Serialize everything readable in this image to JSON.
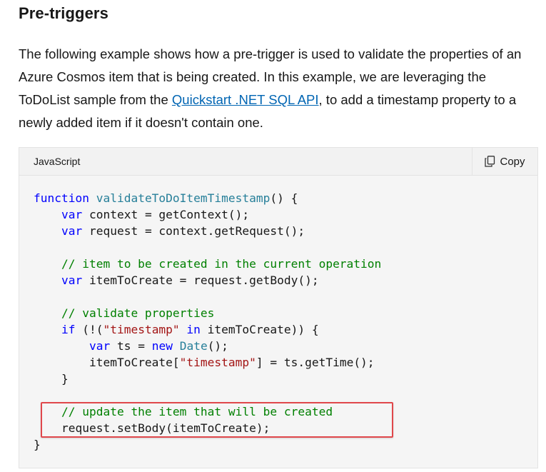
{
  "heading": "Pre-triggers",
  "paragraph": {
    "before_link": "The following example shows how a pre-trigger is used to validate the properties of an Azure Cosmos item that is being created. In this example, we are leveraging the ToDoList sample from the ",
    "link_text": "Quickstart .NET SQL API",
    "after_link": ", to add a timestamp property to a newly added item if it doesn't contain one."
  },
  "code_block": {
    "language": "JavaScript",
    "copy_label": "Copy",
    "copy_icon": "copy-icon",
    "highlight_color": "#e0474b",
    "lines": {
      "l1_kw": "function",
      "l1_fn": "validateToDoItemTimestamp",
      "l1_rest": "() {",
      "l2_kw": "var",
      "l2_rest": " context = getContext();",
      "l3_kw": "var",
      "l3_rest": " request = context.getRequest();",
      "l5_cm": "// item to be created in the current operation",
      "l6_kw": "var",
      "l6_rest": " itemToCreate = request.getBody();",
      "l8_cm": "// validate properties",
      "l9_kw": "if",
      "l9_a": " (!(",
      "l9_st": "\"timestamp\"",
      "l9_in": "in",
      "l9_rest": " itemToCreate)) {",
      "l10_kw": "var",
      "l10_a": " ts = ",
      "l10_new": "new",
      "l10_date": "Date",
      "l10_rest": "();",
      "l11_a": "itemToCreate[",
      "l11_st": "\"timestamp\"",
      "l11_rest": "] = ts.getTime();",
      "l12": "}",
      "l14_cm": "// update the item that will be created",
      "l15": "request.setBody(itemToCreate);",
      "l16": "}"
    }
  }
}
